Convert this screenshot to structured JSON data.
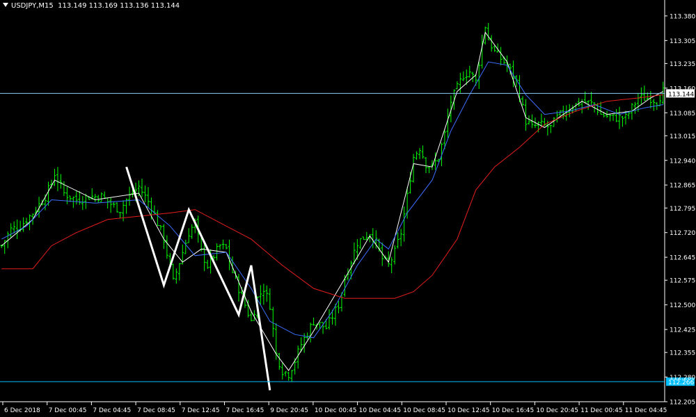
{
  "header": {
    "symbol": "USDJPY,M15",
    "ohlc": "113.149 113.169 113.136 113.144"
  },
  "colors": {
    "background": "#000000",
    "candles": "#00ff00",
    "ma_fast": "#ffffff",
    "ma_mid": "#3d6fff",
    "ma_slow": "#e61e1e",
    "zigzag": "#ffffff",
    "price_line": "#87cefa",
    "h_line": "#00bfff",
    "axis_text": "#ffffff"
  },
  "chart_data": {
    "type": "line",
    "title": "USDJPY,M15",
    "ylim": [
      112.205,
      113.42
    ],
    "y_ticks": [
      "113.380",
      "113.305",
      "113.235",
      "113.160",
      "113.085",
      "113.015",
      "112.940",
      "112.865",
      "112.795",
      "112.720",
      "112.645",
      "112.575",
      "112.500",
      "112.425",
      "112.355",
      "112.280",
      "112.205"
    ],
    "x_ticks": [
      "6 Dec 2018",
      "7 Dec 00:45",
      "7 Dec 04:45",
      "7 Dec 08:45",
      "7 Dec 12:45",
      "7 Dec 16:45",
      "9 Dec 20:45",
      "10 Dec 00:45",
      "10 Dec 04:45",
      "10 Dec 08:45",
      "10 Dec 12:45",
      "10 Dec 16:45",
      "10 Dec 20:45",
      "11 Dec 00:45",
      "11 Dec 04:45"
    ],
    "current_price": 113.144,
    "current_price_label": "113.144",
    "h_line_price": 112.266,
    "h_line_label": "112.266",
    "close_anchors": [
      [
        0,
        112.68
      ],
      [
        3,
        112.73
      ],
      [
        6,
        112.74
      ],
      [
        10,
        112.78
      ],
      [
        14,
        112.83
      ],
      [
        16,
        112.87
      ],
      [
        17,
        112.9
      ],
      [
        20,
        112.84
      ],
      [
        24,
        112.82
      ],
      [
        28,
        112.83
      ],
      [
        32,
        112.83
      ],
      [
        36,
        112.8
      ],
      [
        38,
        112.79
      ],
      [
        40,
        112.82
      ],
      [
        44,
        112.86
      ],
      [
        46,
        112.83
      ],
      [
        48,
        112.8
      ],
      [
        52,
        112.7
      ],
      [
        55,
        112.57
      ],
      [
        58,
        112.66
      ],
      [
        60,
        112.72
      ],
      [
        62,
        112.75
      ],
      [
        64,
        112.66
      ],
      [
        66,
        112.62
      ],
      [
        70,
        112.68
      ],
      [
        72,
        112.67
      ],
      [
        74,
        112.6
      ],
      [
        76,
        112.55
      ],
      [
        78,
        112.5
      ],
      [
        80,
        112.45
      ],
      [
        82,
        112.52
      ],
      [
        84,
        112.55
      ],
      [
        86,
        112.5
      ],
      [
        88,
        112.35
      ],
      [
        90,
        112.3
      ],
      [
        92,
        112.29
      ],
      [
        94,
        112.33
      ],
      [
        96,
        112.38
      ],
      [
        100,
        112.45
      ],
      [
        104,
        112.43
      ],
      [
        108,
        112.5
      ],
      [
        110,
        112.58
      ],
      [
        114,
        112.69
      ],
      [
        118,
        112.72
      ],
      [
        120,
        112.69
      ],
      [
        122,
        112.64
      ],
      [
        124,
        112.62
      ],
      [
        126,
        112.66
      ],
      [
        128,
        112.72
      ],
      [
        130,
        112.83
      ],
      [
        132,
        112.95
      ],
      [
        134,
        112.98
      ],
      [
        136,
        112.93
      ],
      [
        138,
        112.92
      ],
      [
        140,
        112.95
      ],
      [
        142,
        113.02
      ],
      [
        144,
        113.12
      ],
      [
        148,
        113.2
      ],
      [
        150,
        113.21
      ],
      [
        152,
        113.18
      ],
      [
        154,
        113.3
      ],
      [
        155,
        113.35
      ],
      [
        156,
        113.31
      ],
      [
        158,
        113.27
      ],
      [
        162,
        113.23
      ],
      [
        165,
        113.18
      ],
      [
        168,
        113.06
      ],
      [
        170,
        113.04
      ],
      [
        172,
        113.05
      ],
      [
        176,
        113.04
      ],
      [
        178,
        113.07
      ],
      [
        182,
        113.1
      ],
      [
        186,
        113.12
      ],
      [
        190,
        113.11
      ],
      [
        192,
        113.08
      ],
      [
        196,
        113.07
      ],
      [
        200,
        113.07
      ],
      [
        202,
        113.1
      ],
      [
        204,
        113.13
      ],
      [
        208,
        113.13
      ],
      [
        210,
        113.12
      ],
      [
        212,
        113.15
      ]
    ],
    "series": [
      {
        "values": [
          [
            0,
            112.68
          ],
          [
            10,
            112.76
          ],
          [
            17,
            112.88
          ],
          [
            30,
            112.82
          ],
          [
            44,
            112.84
          ],
          [
            52,
            112.7
          ],
          [
            58,
            112.63
          ],
          [
            64,
            112.67
          ],
          [
            72,
            112.66
          ],
          [
            80,
            112.48
          ],
          [
            88,
            112.35
          ],
          [
            92,
            112.3
          ],
          [
            100,
            112.42
          ],
          [
            110,
            112.58
          ],
          [
            118,
            112.71
          ],
          [
            124,
            112.63
          ],
          [
            132,
            112.93
          ],
          [
            138,
            112.92
          ],
          [
            146,
            113.15
          ],
          [
            152,
            113.2
          ],
          [
            155,
            113.33
          ],
          [
            162,
            113.24
          ],
          [
            168,
            113.07
          ],
          [
            174,
            113.04
          ],
          [
            186,
            113.12
          ],
          [
            194,
            113.08
          ],
          [
            202,
            113.09
          ],
          [
            208,
            113.13
          ],
          [
            212,
            113.15
          ]
        ]
      },
      {
        "values": [
          [
            0,
            112.7
          ],
          [
            8,
            112.74
          ],
          [
            16,
            112.82
          ],
          [
            30,
            112.81
          ],
          [
            44,
            112.82
          ],
          [
            54,
            112.74
          ],
          [
            62,
            112.65
          ],
          [
            72,
            112.66
          ],
          [
            80,
            112.55
          ],
          [
            86,
            112.45
          ],
          [
            94,
            112.41
          ],
          [
            100,
            112.4
          ],
          [
            106,
            112.48
          ],
          [
            114,
            112.62
          ],
          [
            120,
            112.7
          ],
          [
            124,
            112.67
          ],
          [
            130,
            112.78
          ],
          [
            138,
            112.88
          ],
          [
            144,
            113.03
          ],
          [
            150,
            113.14
          ],
          [
            156,
            113.24
          ],
          [
            162,
            113.23
          ],
          [
            168,
            113.14
          ],
          [
            174,
            113.08
          ],
          [
            182,
            113.09
          ],
          [
            190,
            113.11
          ],
          [
            198,
            113.08
          ],
          [
            206,
            113.1
          ],
          [
            212,
            113.11
          ]
        ]
      },
      {
        "values": [
          [
            0,
            112.61
          ],
          [
            10,
            112.61
          ],
          [
            16,
            112.68
          ],
          [
            24,
            112.72
          ],
          [
            34,
            112.76
          ],
          [
            44,
            112.77
          ],
          [
            54,
            112.78
          ],
          [
            62,
            112.79
          ],
          [
            72,
            112.74
          ],
          [
            80,
            112.7
          ],
          [
            90,
            112.62
          ],
          [
            100,
            112.55
          ],
          [
            110,
            112.52
          ],
          [
            120,
            112.52
          ],
          [
            126,
            112.52
          ],
          [
            132,
            112.54
          ],
          [
            138,
            112.59
          ],
          [
            146,
            112.7
          ],
          [
            152,
            112.85
          ],
          [
            158,
            112.92
          ],
          [
            166,
            112.98
          ],
          [
            174,
            113.05
          ],
          [
            184,
            113.09
          ],
          [
            194,
            113.12
          ],
          [
            204,
            113.13
          ],
          [
            212,
            113.14
          ]
        ]
      }
    ],
    "zigzag": [
      [
        40,
        112.92
      ],
      [
        52,
        112.56
      ],
      [
        60,
        112.79
      ],
      [
        76,
        112.47
      ],
      [
        80,
        112.62
      ],
      [
        86,
        112.24
      ]
    ]
  }
}
